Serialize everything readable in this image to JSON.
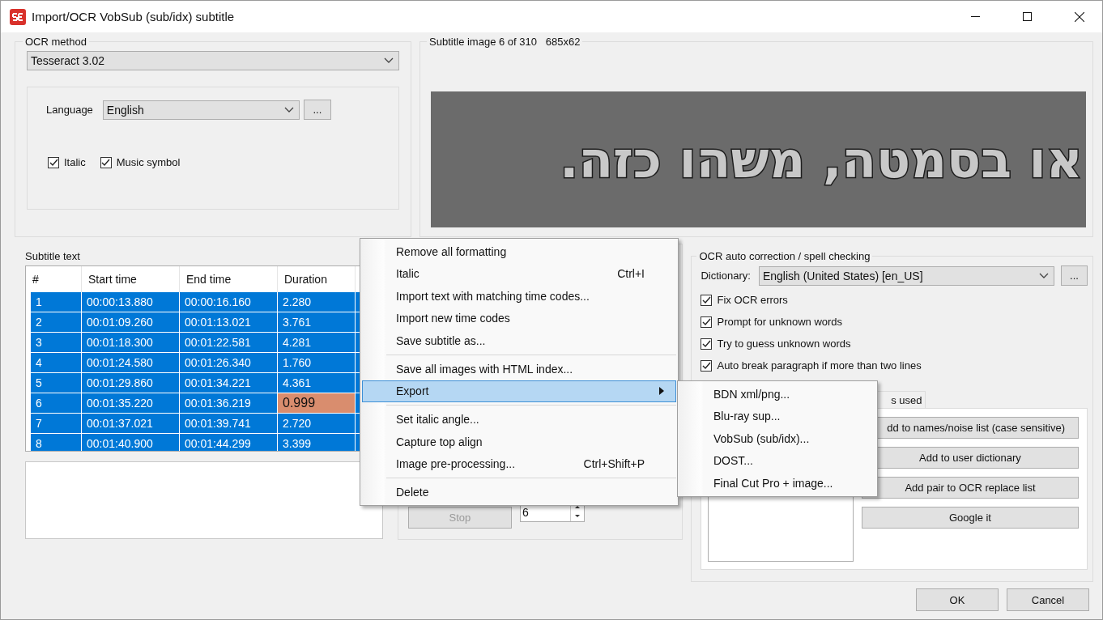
{
  "window": {
    "title": "Import/OCR VobSub (sub/idx) subtitle"
  },
  "ocr_method": {
    "label": "OCR method",
    "engine": "Tesseract 3.02",
    "language_label": "Language",
    "language": "English",
    "more_button": "...",
    "options": [
      {
        "label": "Italic",
        "checked": true
      },
      {
        "label": "Music symbol",
        "checked": true
      }
    ]
  },
  "subtitle_image": {
    "label": "Subtitle image 6 of 310",
    "size": "685x62",
    "text": "או בסמטה, משהו כזה."
  },
  "subtitle_text": {
    "label": "Subtitle text",
    "columns": [
      "#",
      "Start time",
      "End time",
      "Duration"
    ],
    "rows": [
      {
        "cells": [
          "1",
          "00:00:13.880",
          "00:00:16.160",
          "2.280"
        ],
        "selected": true,
        "duration_warning": false
      },
      {
        "cells": [
          "2",
          "00:01:09.260",
          "00:01:13.021",
          "3.761"
        ],
        "selected": true,
        "duration_warning": false
      },
      {
        "cells": [
          "3",
          "00:01:18.300",
          "00:01:22.581",
          "4.281"
        ],
        "selected": true,
        "duration_warning": false
      },
      {
        "cells": [
          "4",
          "00:01:24.580",
          "00:01:26.340",
          "1.760"
        ],
        "selected": true,
        "duration_warning": false
      },
      {
        "cells": [
          "5",
          "00:01:29.860",
          "00:01:34.221",
          "4.361"
        ],
        "selected": true,
        "duration_warning": false
      },
      {
        "cells": [
          "6",
          "00:01:35.220",
          "00:01:36.219",
          "0.999"
        ],
        "selected": true,
        "duration_warning": true
      },
      {
        "cells": [
          "7",
          "00:01:37.021",
          "00:01:39.741",
          "2.720"
        ],
        "selected": true,
        "duration_warning": false
      },
      {
        "cells": [
          "8",
          "00:01:40.900",
          "00:01:44.299",
          "3.399"
        ],
        "selected": true,
        "duration_warning": false
      }
    ]
  },
  "ocr_controls": {
    "stop_button": {
      "label": "Stop",
      "disabled": true
    },
    "spinner_value": "6"
  },
  "spell_check": {
    "label": "OCR auto correction / spell checking",
    "dictionary_label": "Dictionary:",
    "dictionary": "English (United States) [en_US]",
    "more_button": "...",
    "options": [
      {
        "label": "Fix OCR errors",
        "checked": true
      },
      {
        "label": "Prompt for unknown words",
        "checked": true
      },
      {
        "label": "Try to guess unknown words",
        "checked": true
      },
      {
        "label": "Auto break paragraph if more than two lines",
        "checked": true
      }
    ],
    "tab": "s used",
    "buttons": [
      "dd to names/noise list (case sensitive)",
      "Add to user dictionary",
      "Add pair to OCR replace list",
      "Google it"
    ]
  },
  "context_menu": {
    "items": [
      {
        "kind": "item",
        "label": "Remove all formatting",
        "selected": false,
        "submenu": false
      },
      {
        "kind": "item",
        "label": "Italic",
        "shortcut": "Ctrl+I",
        "selected": false,
        "submenu": false
      },
      {
        "kind": "item",
        "label": "Import text with matching time codes...",
        "selected": false,
        "submenu": false
      },
      {
        "kind": "item",
        "label": "Import new time codes",
        "selected": false,
        "submenu": false
      },
      {
        "kind": "item",
        "label": "Save subtitle as...",
        "selected": false,
        "submenu": false
      },
      {
        "kind": "separator"
      },
      {
        "kind": "item",
        "label": "Save all images with HTML index...",
        "selected": false,
        "submenu": false
      },
      {
        "kind": "item",
        "label": "Export",
        "selected": true,
        "submenu": true
      },
      {
        "kind": "separator"
      },
      {
        "kind": "item",
        "label": "Set italic angle...",
        "selected": false,
        "submenu": false
      },
      {
        "kind": "item",
        "label": "Capture top align",
        "selected": false,
        "submenu": false
      },
      {
        "kind": "item",
        "label": "Image pre-processing...",
        "shortcut": "Ctrl+Shift+P",
        "selected": false,
        "submenu": false
      },
      {
        "kind": "separator"
      },
      {
        "kind": "item",
        "label": "Delete",
        "selected": false,
        "submenu": false
      }
    ]
  },
  "submenu": {
    "items": [
      "BDN xml/png...",
      "Blu-ray sup...",
      "VobSub (sub/idx)...",
      "DOST...",
      "Final Cut Pro + image..."
    ]
  },
  "buttons": [
    "OK",
    "Cancel"
  ]
}
